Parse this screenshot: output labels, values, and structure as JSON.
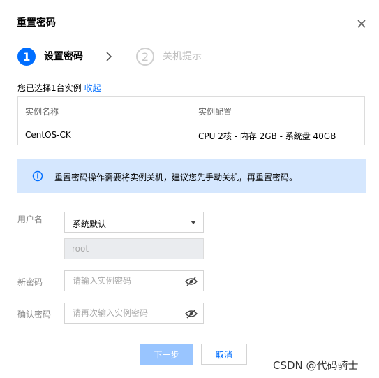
{
  "dialog": {
    "title": "重置密码"
  },
  "steps": [
    {
      "number": "1",
      "label": "设置密码"
    },
    {
      "number": "2",
      "label": "关机提示"
    }
  ],
  "selection": {
    "text": "您已选择1台实例",
    "toggle_link": "收起"
  },
  "table": {
    "headers": [
      "实例名称",
      "实例配置"
    ],
    "rows": [
      [
        "CentOS-CK",
        "CPU 2核 - 内存 2GB - 系统盘 40GB"
      ]
    ]
  },
  "notice": {
    "text": "重置密码操作需要将实例关机，建议您先手动关机，再重置密码。"
  },
  "form": {
    "username_label": "用户名",
    "username_select_value": "系统默认",
    "username_input_value": "root",
    "new_password_label": "新密码",
    "new_password_placeholder": "请输入实例密码",
    "confirm_password_label": "确认密码",
    "confirm_password_placeholder": "请再次输入实例密码"
  },
  "buttons": {
    "next": "下一步",
    "cancel": "取消"
  },
  "watermark": "CSDN @代码骑士",
  "colors": {
    "primary": "#006eff",
    "notice_bg": "#d5e7fe",
    "next_disabled": "#99c5ff"
  },
  "icons": {
    "close": "close-icon",
    "step_arrow": "chevron-right-icon",
    "info": "info-icon",
    "password_toggle": "eye-off-icon",
    "select_caret": "caret-down-icon"
  }
}
